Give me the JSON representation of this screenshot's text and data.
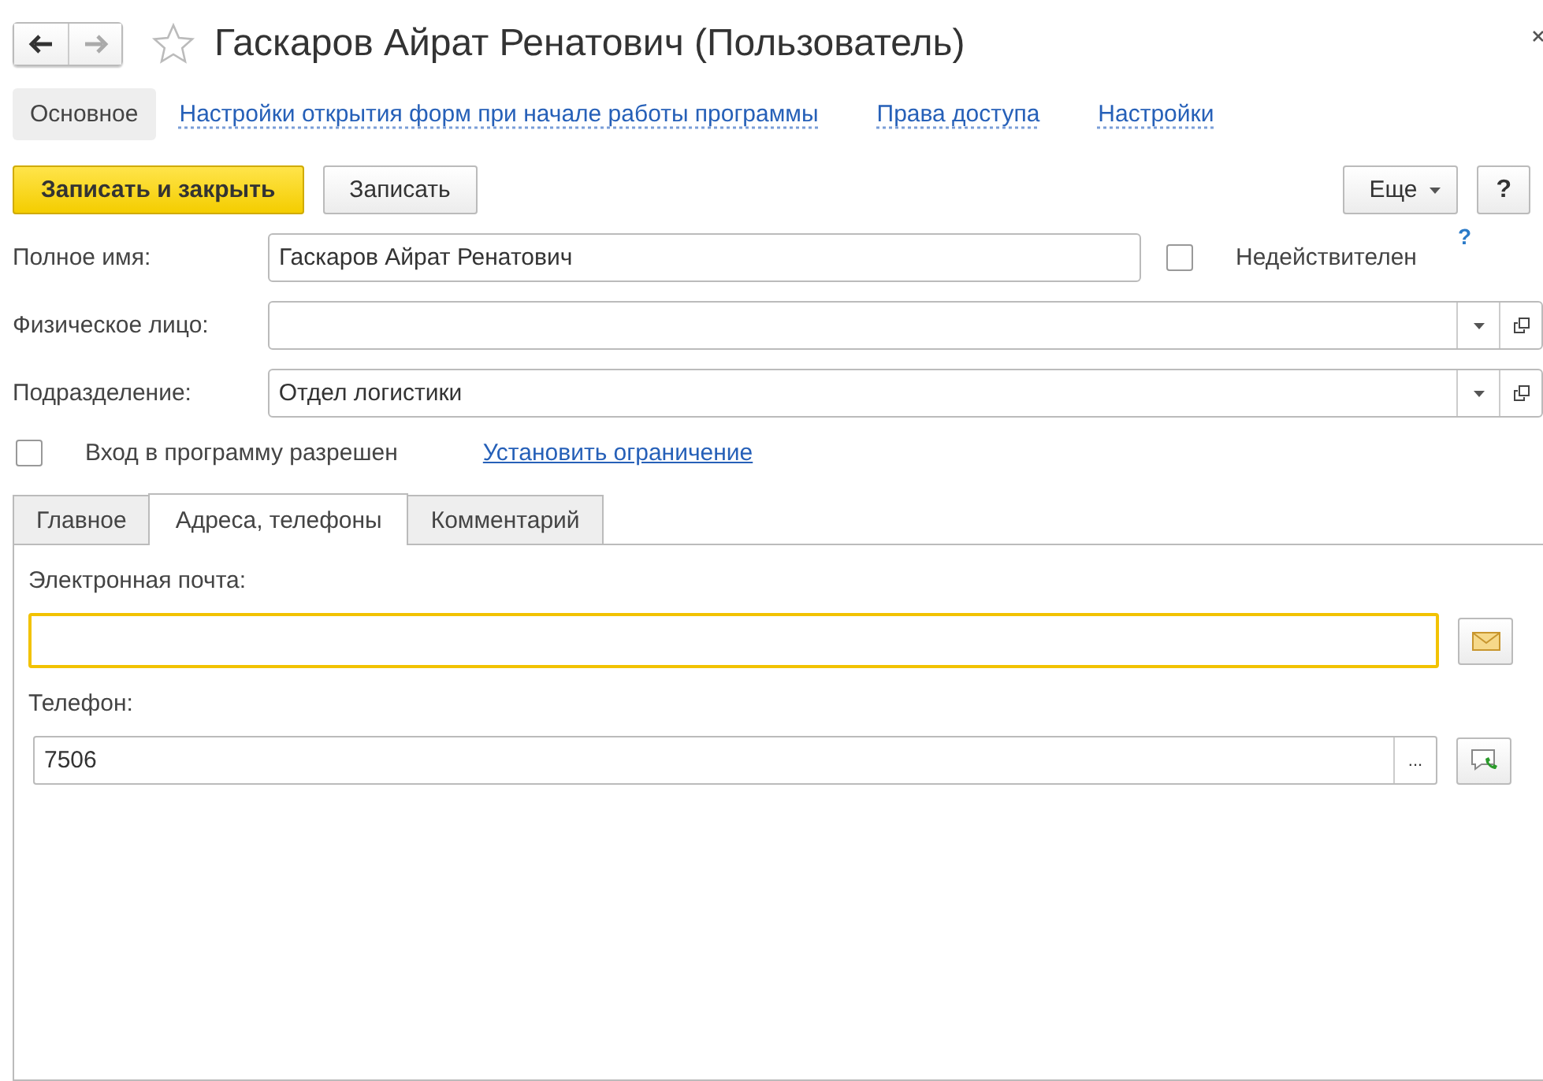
{
  "window": {
    "title": "Гаскаров Айрат Ренатович (Пользователь)",
    "favorite": false
  },
  "nav": [
    {
      "label": "Основное",
      "selected": true
    },
    {
      "label": "Настройки открытия форм при начале работы программы",
      "selected": false
    },
    {
      "label": "Права доступа",
      "selected": false
    },
    {
      "label": "Настройки",
      "selected": false
    }
  ],
  "toolbar": {
    "primary": "Записать и закрыть",
    "secondary": "Записать",
    "more": "Еще",
    "help": "?"
  },
  "fields": [
    {
      "kind": "text",
      "label": "Полное имя:",
      "value": "Гаскаров Айрат Ренатович"
    },
    {
      "kind": "select",
      "label": "Физическое лицо:"
    },
    {
      "kind": "select",
      "label": "Подразделение:",
      "value": "Отдел логистики"
    }
  ],
  "invalid": {
    "label": "Недействителен",
    "checked": false,
    "help": "?"
  },
  "login": {
    "label": "Вход в программу разрешен",
    "checked": false,
    "link": "Установить ограничение"
  },
  "tabs": [
    {
      "label": "Главное",
      "selected": false
    },
    {
      "label": "Адреса, телефоны",
      "selected": true
    },
    {
      "label": "Комментарий",
      "selected": false
    }
  ],
  "contacts": [
    {
      "kind": "email",
      "label": "Электронная почта:",
      "focused": true
    },
    {
      "kind": "phone",
      "label": "Телефон:",
      "value": "7506",
      "focused": false,
      "button": "..."
    }
  ]
}
